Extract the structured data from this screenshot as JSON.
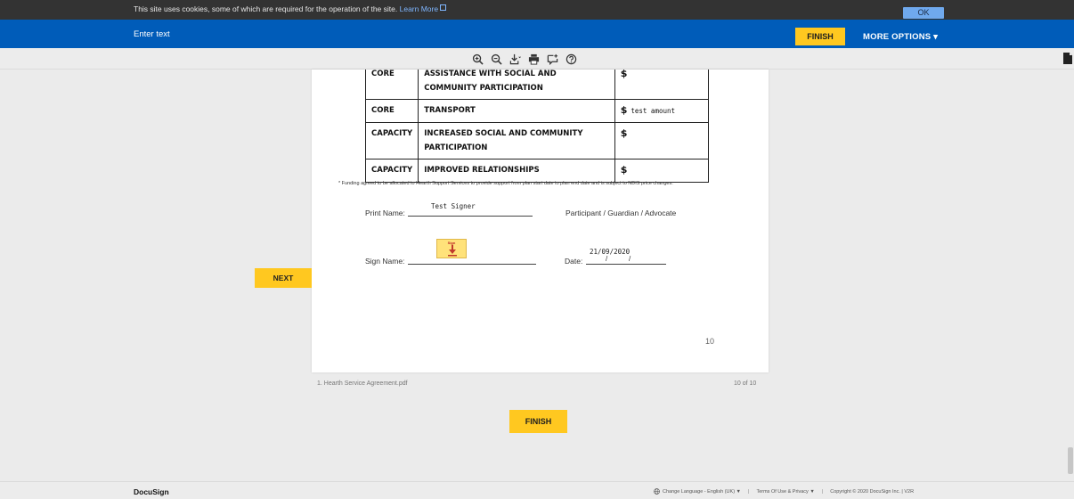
{
  "cookie_banner": {
    "message": "This site uses cookies, some of which are required for the operation of the site.",
    "link": "Learn More",
    "ok_label": "OK"
  },
  "header": {
    "input_placeholder": "Enter text",
    "finish_label": "FINISH",
    "more_options_label": "MORE OPTIONS ▾"
  },
  "toolbar": {
    "icons": [
      "zoom-in-icon",
      "zoom-out-icon",
      "download-icon",
      "print-icon",
      "comment-icon",
      "help-icon"
    ]
  },
  "document": {
    "table": [
      {
        "type": "CORE",
        "desc": "ASSISTANCE WITH SOCIAL AND COMMUNITY PARTICIPATION",
        "currency": "$",
        "amount": ""
      },
      {
        "type": "CORE",
        "desc": "TRANSPORT",
        "currency": "$",
        "amount": "test amount"
      },
      {
        "type": "CAPACITY",
        "desc": "INCREASED SOCIAL AND COMMUNITY PARTICIPATION",
        "currency": "$",
        "amount": ""
      },
      {
        "type": "CAPACITY",
        "desc": "IMPROVED RELATIONSHIPS",
        "currency": "$",
        "amount": ""
      }
    ],
    "footnote": "* Funding agreed to be allocated to Hearth Support Services to provide support from plan start date to plan end date and is subject to NDIS price changes.",
    "print_name_label": "Print Name:",
    "print_name_value": "Test Signer",
    "role_text": "Participant  /  Guardian / Advocate",
    "sign_name_label": "Sign Name:",
    "sign_tag_label": "Sign",
    "date_label": "Date:",
    "date_value": "21/09/2020",
    "date_separator": "/",
    "page_number": "10"
  },
  "navigation": {
    "next_label": "NEXT",
    "finish_label": "FINISH",
    "filename": "1. Hearth Service Agreement.pdf",
    "page_count": "10 of 10"
  },
  "footer": {
    "brand": "DocuSign",
    "language": "Change Language - English (UK) ▼",
    "terms": "Terms Of Use & Privacy ▼",
    "copyright": "Copyright © 2020 DocuSign Inc. | V2R"
  },
  "colors": {
    "header_blue": "#005cb9",
    "accent_yellow": "#ffc820",
    "cookie_bar": "#333333"
  }
}
